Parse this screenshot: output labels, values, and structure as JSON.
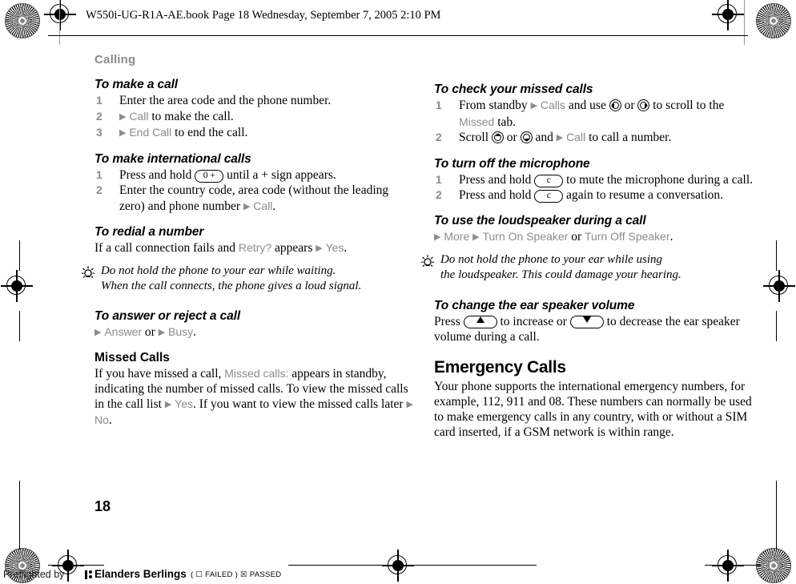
{
  "header": {
    "book_info": "W550i-UG-R1A-AE.book  Page 18  Wednesday, September 7, 2005  2:10 PM"
  },
  "page": {
    "number": "18",
    "chapter_title": "Calling"
  },
  "left_column": {
    "sections": [
      {
        "heading": "To make a call",
        "heading_style": "task",
        "steps": [
          {
            "num": "1",
            "text": "Enter the area code and the phone number."
          },
          {
            "num": "2",
            "pre_arrow": true,
            "ui": "Call",
            "text": " to make the call."
          },
          {
            "num": "3",
            "pre_arrow": true,
            "ui": "End Call",
            "text": " to end the call."
          }
        ]
      },
      {
        "heading": "To make international calls",
        "heading_style": "task",
        "steps": [
          {
            "num": "1",
            "text_before": "Press and hold ",
            "key": "0 +",
            "text_after": " until a + sign appears."
          },
          {
            "num": "2",
            "text_before": "Enter the country code, area code (without the leading zero) and phone number ",
            "ui": "Call",
            "text_after": "."
          }
        ]
      },
      {
        "heading": "To redial a number",
        "heading_style": "task",
        "body_before": "If a call connection fails and ",
        "ui_1": "Retry?",
        "body_mid": " appears ",
        "ui_2": "Yes",
        "body_after": "."
      }
    ],
    "tip": {
      "icon": "lightbulb-icon",
      "lines": [
        "Do not hold the phone to your ear while waiting.",
        "When the call connects, the phone gives a loud signal."
      ]
    },
    "sections_2": [
      {
        "heading": "To answer or reject a call",
        "heading_style": "task",
        "ui_1": "Answer",
        "mid": " or ",
        "ui_2": "Busy",
        "after": "."
      },
      {
        "heading": "Missed Calls",
        "heading_style": "section",
        "paragraph_parts": {
          "p1": "If you have missed a call, ",
          "ui1": "Missed calls:",
          "p2": " appears in standby, indicating the number of missed calls. To view the missed calls in the call list ",
          "ui2": "Yes",
          "p3": ". If you want to view the missed calls later ",
          "ui3": "No",
          "p4": "."
        }
      }
    ]
  },
  "right_column": {
    "sections": [
      {
        "heading": "To check your missed calls",
        "heading_style": "task",
        "steps": [
          {
            "num": "1",
            "t1": "From standby ",
            "ui1": "Calls",
            "t2": " and use ",
            "key1": "nav-left-icon",
            "t3": " or ",
            "key2": "nav-right-icon",
            "t4": " to scroll to the ",
            "ui2": "Missed",
            "t5": " tab."
          },
          {
            "num": "2",
            "t1": "Scroll ",
            "key1": "nav-up-icon",
            "t2": " or ",
            "key2": "nav-down-icon",
            "t3": " and ",
            "ui1": "Call",
            "t4": " to call a number."
          }
        ]
      },
      {
        "heading": "To turn off the microphone",
        "heading_style": "task",
        "steps": [
          {
            "num": "1",
            "text_before": "Press and hold ",
            "key": "c",
            "text_after": " to mute the microphone during a call."
          },
          {
            "num": "2",
            "text_before": "Press and hold ",
            "key": "c",
            "text_after": " again to resume a conversation."
          }
        ]
      },
      {
        "heading": "To use the loudspeaker during a call",
        "heading_style": "task",
        "ui_1": "More",
        "ui_2": "Turn On Speaker",
        "mid": " or ",
        "ui_3": "Turn Off Speaker",
        "after": "."
      }
    ],
    "tip": {
      "icon": "lightbulb-icon",
      "lines": [
        "Do not hold the phone to your ear while using",
        "the loudspeaker. This could damage your hearing."
      ]
    },
    "sections_2": [
      {
        "heading": "To change the ear speaker volume",
        "heading_style": "task",
        "t1": "Press ",
        "key_up": "volume-up-key",
        "t2": " to increase or ",
        "key_down": "volume-down-key",
        "t3": " to decrease the ear speaker volume during a call."
      },
      {
        "heading": "Emergency Calls",
        "heading_style": "big",
        "paragraph": "Your phone supports the international emergency numbers, for example, 112, 911 and 08. These numbers can normally be used to make emergency calls in any country, with or without a SIM card inserted, if a GSM network is within range."
      }
    ]
  },
  "footer": {
    "preflight_text": "Preflighted by",
    "brand": "Elanders Berlings",
    "marks": "(  ☐  FAILED  )   ☒  PASSED"
  },
  "colors": {
    "ui_term_gray": "#8c8c8c",
    "chapter_gray": "#8c8c8c",
    "text_black": "#000000"
  }
}
